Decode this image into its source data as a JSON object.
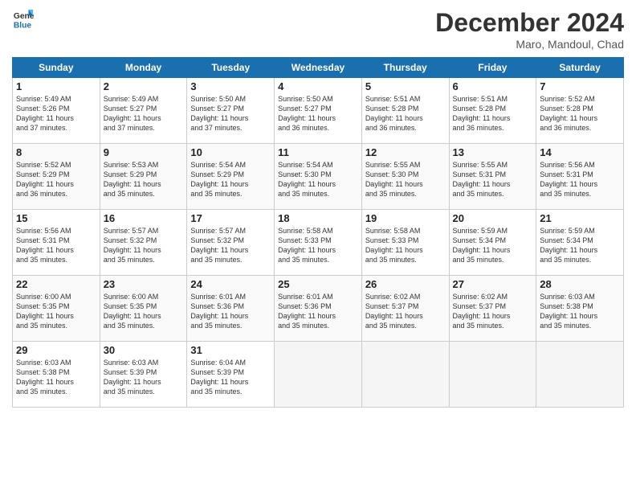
{
  "header": {
    "logo_line1": "General",
    "logo_line2": "Blue",
    "month": "December 2024",
    "location": "Maro, Mandoul, Chad"
  },
  "days_of_week": [
    "Sunday",
    "Monday",
    "Tuesday",
    "Wednesday",
    "Thursday",
    "Friday",
    "Saturday"
  ],
  "weeks": [
    [
      {
        "day": "1",
        "info": "Sunrise: 5:49 AM\nSunset: 5:26 PM\nDaylight: 11 hours\nand 37 minutes."
      },
      {
        "day": "2",
        "info": "Sunrise: 5:49 AM\nSunset: 5:27 PM\nDaylight: 11 hours\nand 37 minutes."
      },
      {
        "day": "3",
        "info": "Sunrise: 5:50 AM\nSunset: 5:27 PM\nDaylight: 11 hours\nand 37 minutes."
      },
      {
        "day": "4",
        "info": "Sunrise: 5:50 AM\nSunset: 5:27 PM\nDaylight: 11 hours\nand 36 minutes."
      },
      {
        "day": "5",
        "info": "Sunrise: 5:51 AM\nSunset: 5:28 PM\nDaylight: 11 hours\nand 36 minutes."
      },
      {
        "day": "6",
        "info": "Sunrise: 5:51 AM\nSunset: 5:28 PM\nDaylight: 11 hours\nand 36 minutes."
      },
      {
        "day": "7",
        "info": "Sunrise: 5:52 AM\nSunset: 5:28 PM\nDaylight: 11 hours\nand 36 minutes."
      }
    ],
    [
      {
        "day": "8",
        "info": "Sunrise: 5:52 AM\nSunset: 5:29 PM\nDaylight: 11 hours\nand 36 minutes."
      },
      {
        "day": "9",
        "info": "Sunrise: 5:53 AM\nSunset: 5:29 PM\nDaylight: 11 hours\nand 35 minutes."
      },
      {
        "day": "10",
        "info": "Sunrise: 5:54 AM\nSunset: 5:29 PM\nDaylight: 11 hours\nand 35 minutes."
      },
      {
        "day": "11",
        "info": "Sunrise: 5:54 AM\nSunset: 5:30 PM\nDaylight: 11 hours\nand 35 minutes."
      },
      {
        "day": "12",
        "info": "Sunrise: 5:55 AM\nSunset: 5:30 PM\nDaylight: 11 hours\nand 35 minutes."
      },
      {
        "day": "13",
        "info": "Sunrise: 5:55 AM\nSunset: 5:31 PM\nDaylight: 11 hours\nand 35 minutes."
      },
      {
        "day": "14",
        "info": "Sunrise: 5:56 AM\nSunset: 5:31 PM\nDaylight: 11 hours\nand 35 minutes."
      }
    ],
    [
      {
        "day": "15",
        "info": "Sunrise: 5:56 AM\nSunset: 5:31 PM\nDaylight: 11 hours\nand 35 minutes."
      },
      {
        "day": "16",
        "info": "Sunrise: 5:57 AM\nSunset: 5:32 PM\nDaylight: 11 hours\nand 35 minutes."
      },
      {
        "day": "17",
        "info": "Sunrise: 5:57 AM\nSunset: 5:32 PM\nDaylight: 11 hours\nand 35 minutes."
      },
      {
        "day": "18",
        "info": "Sunrise: 5:58 AM\nSunset: 5:33 PM\nDaylight: 11 hours\nand 35 minutes."
      },
      {
        "day": "19",
        "info": "Sunrise: 5:58 AM\nSunset: 5:33 PM\nDaylight: 11 hours\nand 35 minutes."
      },
      {
        "day": "20",
        "info": "Sunrise: 5:59 AM\nSunset: 5:34 PM\nDaylight: 11 hours\nand 35 minutes."
      },
      {
        "day": "21",
        "info": "Sunrise: 5:59 AM\nSunset: 5:34 PM\nDaylight: 11 hours\nand 35 minutes."
      }
    ],
    [
      {
        "day": "22",
        "info": "Sunrise: 6:00 AM\nSunset: 5:35 PM\nDaylight: 11 hours\nand 35 minutes."
      },
      {
        "day": "23",
        "info": "Sunrise: 6:00 AM\nSunset: 5:35 PM\nDaylight: 11 hours\nand 35 minutes."
      },
      {
        "day": "24",
        "info": "Sunrise: 6:01 AM\nSunset: 5:36 PM\nDaylight: 11 hours\nand 35 minutes."
      },
      {
        "day": "25",
        "info": "Sunrise: 6:01 AM\nSunset: 5:36 PM\nDaylight: 11 hours\nand 35 minutes."
      },
      {
        "day": "26",
        "info": "Sunrise: 6:02 AM\nSunset: 5:37 PM\nDaylight: 11 hours\nand 35 minutes."
      },
      {
        "day": "27",
        "info": "Sunrise: 6:02 AM\nSunset: 5:37 PM\nDaylight: 11 hours\nand 35 minutes."
      },
      {
        "day": "28",
        "info": "Sunrise: 6:03 AM\nSunset: 5:38 PM\nDaylight: 11 hours\nand 35 minutes."
      }
    ],
    [
      {
        "day": "29",
        "info": "Sunrise: 6:03 AM\nSunset: 5:38 PM\nDaylight: 11 hours\nand 35 minutes."
      },
      {
        "day": "30",
        "info": "Sunrise: 6:03 AM\nSunset: 5:39 PM\nDaylight: 11 hours\nand 35 minutes."
      },
      {
        "day": "31",
        "info": "Sunrise: 6:04 AM\nSunset: 5:39 PM\nDaylight: 11 hours\nand 35 minutes."
      },
      {
        "day": "",
        "info": ""
      },
      {
        "day": "",
        "info": ""
      },
      {
        "day": "",
        "info": ""
      },
      {
        "day": "",
        "info": ""
      }
    ]
  ]
}
